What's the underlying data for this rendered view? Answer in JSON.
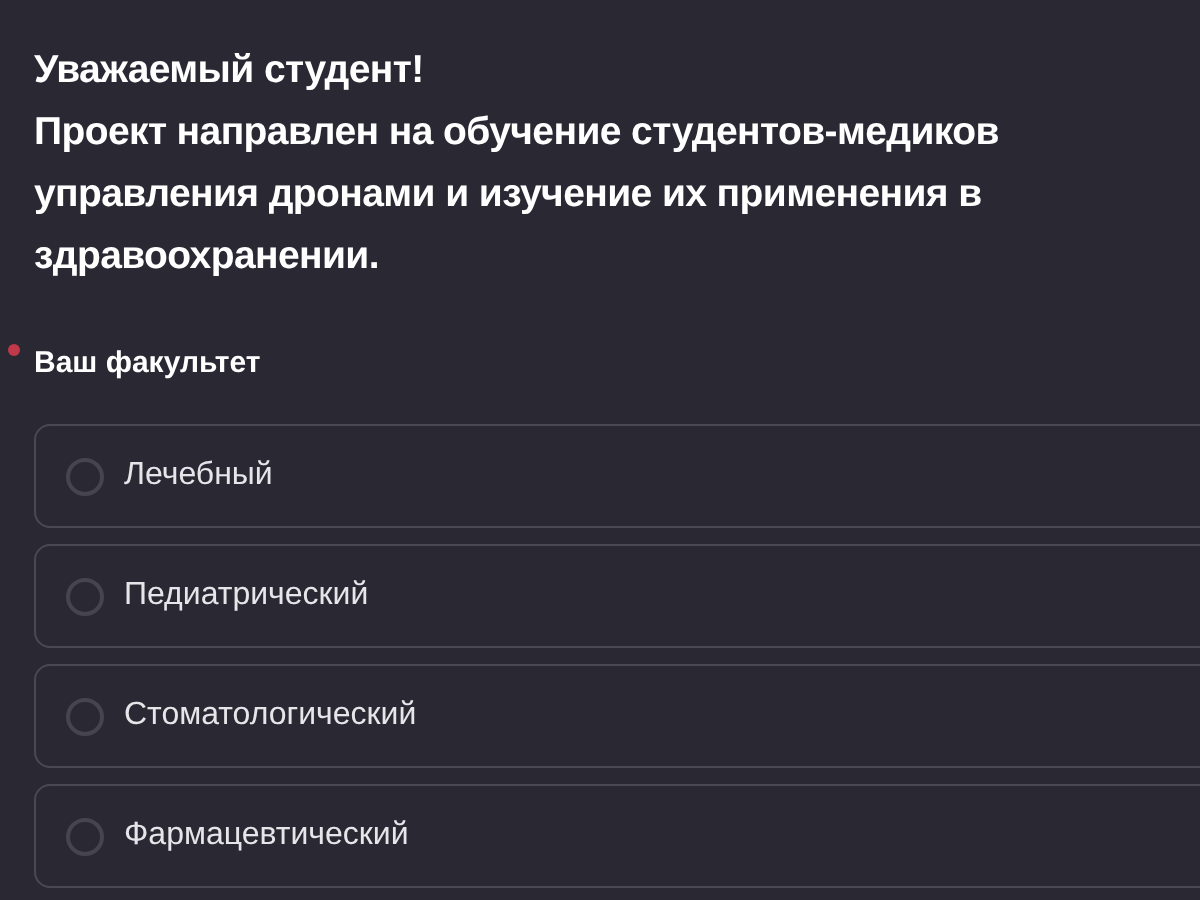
{
  "intro": [
    "Уважаемый студент!",
    "Проект направлен на обучение студентов-медиков управления дронами и изучение их применения в здравоохранении."
  ],
  "question": {
    "label": "Ваш факультет",
    "required": true,
    "options": [
      {
        "label": "Лечебный",
        "selected": false
      },
      {
        "label": "Педиатрический",
        "selected": false
      },
      {
        "label": "Стоматологический",
        "selected": false
      },
      {
        "label": "Фармацевтический",
        "selected": false
      }
    ]
  }
}
